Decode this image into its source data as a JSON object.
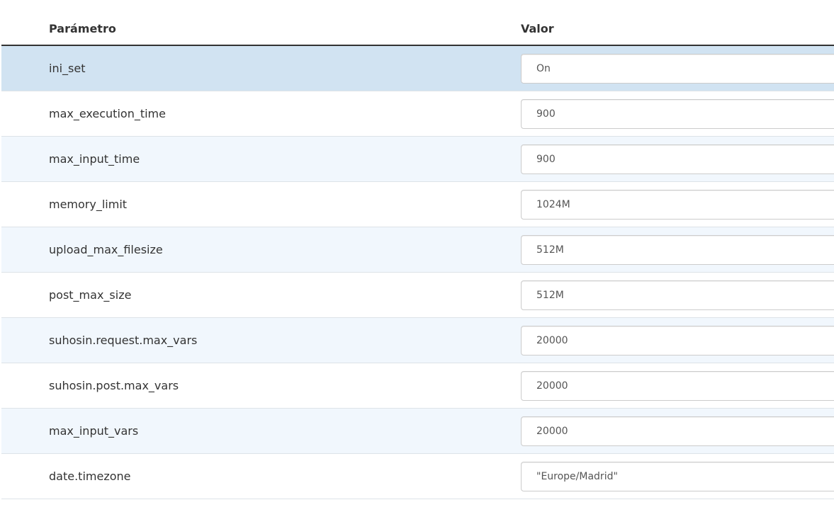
{
  "table": {
    "headers": {
      "param": "Parámetro",
      "value": "Valor"
    },
    "rows": [
      {
        "param": "ini_set",
        "value": "On"
      },
      {
        "param": "max_execution_time",
        "value": "900"
      },
      {
        "param": "max_input_time",
        "value": "900"
      },
      {
        "param": "memory_limit",
        "value": "1024M"
      },
      {
        "param": "upload_max_filesize",
        "value": "512M"
      },
      {
        "param": "post_max_size",
        "value": "512M"
      },
      {
        "param": "suhosin.request.max_vars",
        "value": "20000"
      },
      {
        "param": "suhosin.post.max_vars",
        "value": "20000"
      },
      {
        "param": "max_input_vars",
        "value": "20000"
      },
      {
        "param": "date.timezone",
        "value": "\"Europe/Madrid\""
      }
    ]
  }
}
